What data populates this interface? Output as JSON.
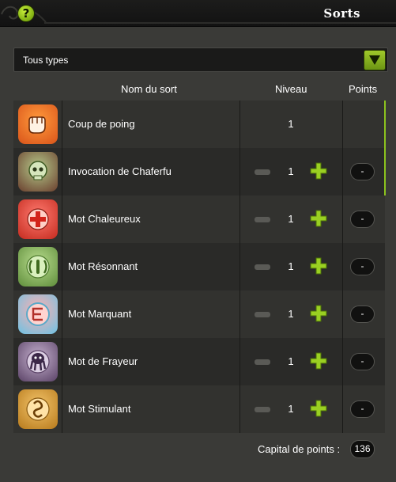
{
  "window": {
    "title": "Sorts",
    "help_label": "?"
  },
  "filter": {
    "selected": "Tous types"
  },
  "table": {
    "headers": {
      "name": "Nom du sort",
      "level": "Niveau",
      "points": "Points"
    },
    "rows": [
      {
        "name": "Coup de poing",
        "level": "1",
        "points": "",
        "icon": "fist-icon",
        "colors": [
          "#ff9a3c",
          "#d9541a"
        ],
        "upgradable": false
      },
      {
        "name": "Invocation de Chaferfu",
        "level": "1",
        "points": "-",
        "icon": "skull-summon-icon",
        "colors": [
          "#b5c98a",
          "#6a3f2e"
        ],
        "upgradable": true
      },
      {
        "name": "Mot Chaleureux",
        "level": "1",
        "points": "-",
        "icon": "heal-cross-icon",
        "colors": [
          "#ff7b70",
          "#c42b1f"
        ],
        "upgradable": true
      },
      {
        "name": "Mot Résonnant",
        "level": "1",
        "points": "-",
        "icon": "sound-wave-icon",
        "colors": [
          "#b9dd8e",
          "#5f8d3b"
        ],
        "upgradable": true
      },
      {
        "name": "Mot Marquant",
        "level": "1",
        "points": "-",
        "icon": "mark-glyph-icon",
        "colors": [
          "#ffb0b0",
          "#6cc2e4"
        ],
        "upgradable": true
      },
      {
        "name": "Mot de Frayeur",
        "level": "1",
        "points": "-",
        "icon": "fear-creature-icon",
        "colors": [
          "#c6b2cf",
          "#5a4266"
        ],
        "upgradable": true
      },
      {
        "name": "Mot Stimulant",
        "level": "1",
        "points": "-",
        "icon": "stimulant-rune-icon",
        "colors": [
          "#f3c46a",
          "#b77a1c"
        ],
        "upgradable": true
      }
    ]
  },
  "footer": {
    "capital_label": "Capital de points :",
    "capital_value": "136"
  },
  "colors": {
    "accent": "#8cc21e",
    "background": "#3a3a37",
    "row_dark": "#2a2a28",
    "row_light": "#32322f"
  }
}
